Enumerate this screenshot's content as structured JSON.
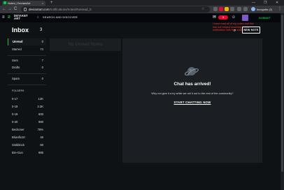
{
  "browser": {
    "tab_title": "Notes | DeviantArt",
    "tab_close": "×",
    "newtab": "+",
    "win_min": "—",
    "win_max": "❐",
    "win_close": "✕",
    "back": "←",
    "forward": "→",
    "reload": "C",
    "url_host": "deviantart.com",
    "url_path": "/notifications/notes/#unread_0",
    "profile_label": "Incognito (2)",
    "menu": "⋮"
  },
  "da_header": {
    "logo_text_top": "DEVIANT",
    "logo_text_bottom": "ART",
    "search_placeholder": "SEARCH AND DISCOVER",
    "notif_count": "1",
    "submit_label": "SUBMIT"
  },
  "note_overlay": "I have read all of my notes and this has not helped resolving a new notification with free claim",
  "sidebar": {
    "title": "Inbox",
    "count": "3",
    "items": [
      {
        "label": "Unread",
        "value": "0",
        "active": true
      },
      {
        "label": "Starred",
        "value": "74",
        "active": false
      },
      {
        "label": "Sent",
        "value": "7",
        "active": false
      },
      {
        "label": "Drafts",
        "value": "0",
        "active": false
      },
      {
        "label": "Spam",
        "value": "0",
        "active": false
      }
    ],
    "folders_heading": "FOLDERS",
    "folders": [
      {
        "label": "0-17",
        "value": "13K"
      },
      {
        "label": "0-19",
        "value": "3.3K"
      },
      {
        "label": "0-19",
        "value": "600"
      },
      {
        "label": "0-20",
        "value": "980"
      },
      {
        "label": "Beckoner",
        "value": "78%"
      },
      {
        "label": "Brianfix10",
        "value": "46"
      },
      {
        "label": "Sinkblock",
        "value": "60"
      },
      {
        "label": "Bre-Gun",
        "value": "985"
      }
    ]
  },
  "middle": {
    "empty_label": "No Unread Notes"
  },
  "panel": {
    "new_message": "NEW NOTE",
    "chat_title": "Chat has arrived!",
    "chat_sub": "Why not give it a try while we roll it out to the rest of the community?",
    "chat_cta": "START CHATTING NOW"
  },
  "colors": {
    "accent": "#05cc47",
    "badge": "#e00b31",
    "note": "#ff3030"
  }
}
